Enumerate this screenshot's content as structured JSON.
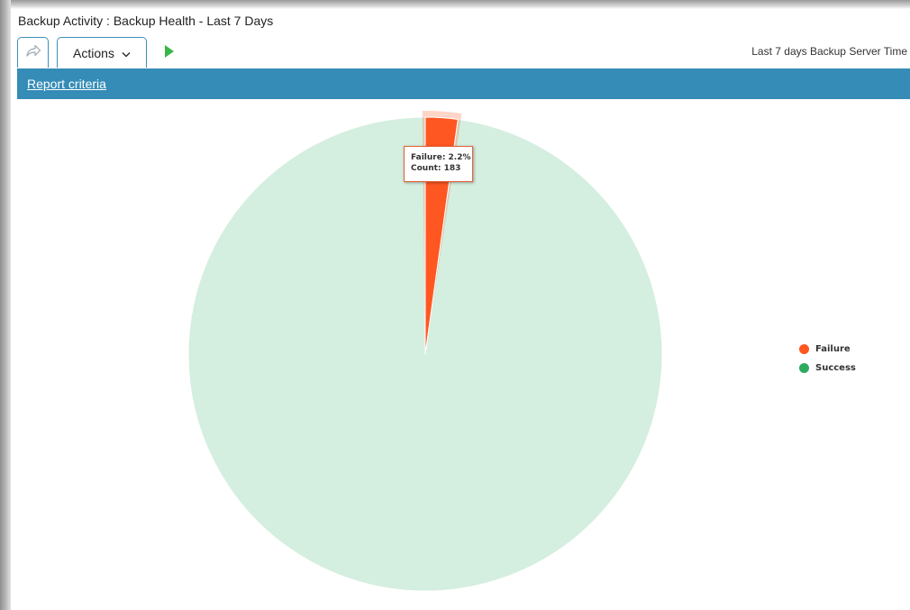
{
  "page": {
    "title": "Backup Activity : Backup Health - Last 7 Days",
    "time_label": "Last 7 days Backup Server Time"
  },
  "toolbar": {
    "share_icon": "share-arrow-icon",
    "actions_label": "Actions",
    "actions_icon": "chevron-down-icon",
    "run_icon": "play-icon",
    "run_color": "#3bb54a"
  },
  "criteria": {
    "link_label": "Report criteria",
    "bar_color": "#358cb6"
  },
  "tooltip": {
    "line1": "Failure: 2.2%",
    "line2": "Count: 183"
  },
  "legend": {
    "items": [
      {
        "label": "Failure",
        "color": "#ff5722"
      },
      {
        "label": "Success",
        "color": "#2eaa5e"
      }
    ]
  },
  "chart_data": {
    "type": "pie",
    "title": "",
    "categories": [
      "Failure",
      "Success"
    ],
    "values": [
      2.2,
      97.8
    ],
    "colors": [
      "#ff5722",
      "#d4eedf"
    ],
    "hovered": "Failure",
    "failure_count": 183,
    "legend_position": "right"
  }
}
